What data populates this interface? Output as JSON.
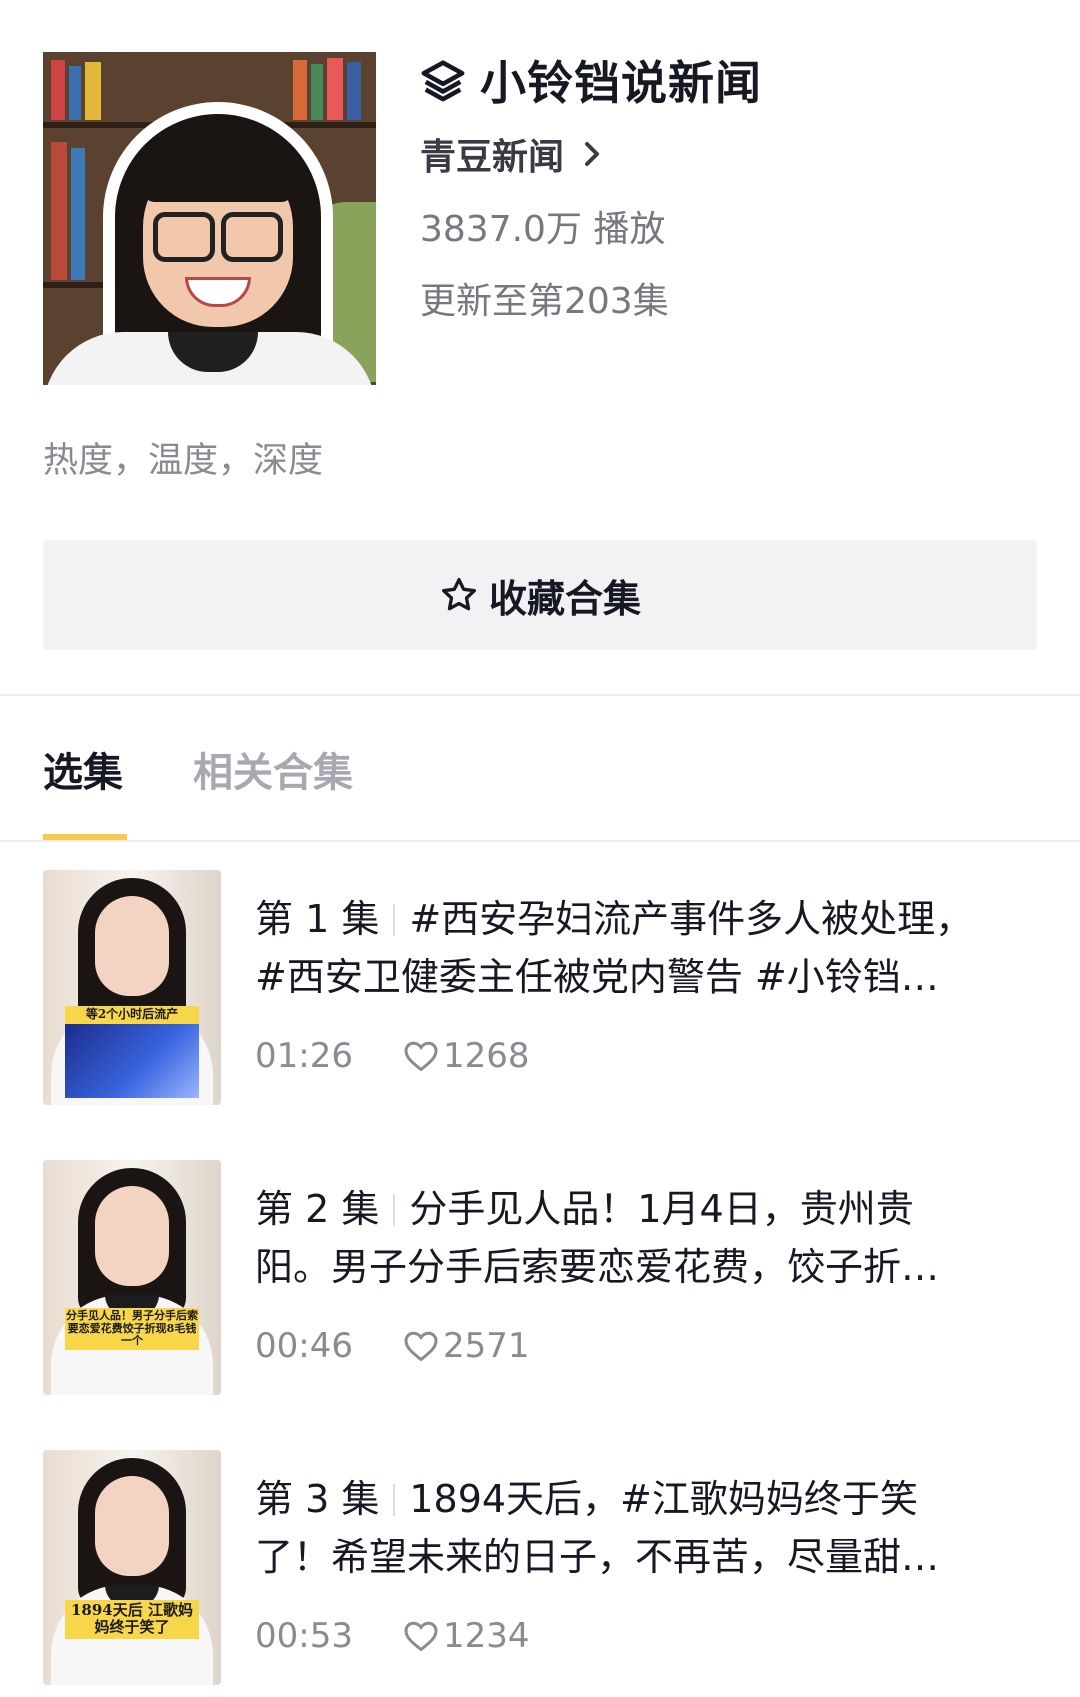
{
  "collection": {
    "title": "小铃铛说新闻",
    "author": "青豆新闻",
    "plays": "3837.0万 播放",
    "updated": "更新至第203集",
    "description": "热度，温度，深度",
    "favorite_label": "收藏合集"
  },
  "tabs": [
    {
      "label": "选集",
      "active": true
    },
    {
      "label": "相关合集",
      "active": false
    }
  ],
  "episodes": [
    {
      "number": "第 1 集",
      "title_line1": "#西安孕妇流产事件多人被处理，",
      "title_line2": "#西安卫健委主任被党内警告 #小铃铛…",
      "duration": "01:26",
      "likes": "1268",
      "thumb_caption": "等2个小时后流产"
    },
    {
      "number": "第 2 集",
      "title_line1": "分手见人品！1月4日，贵州贵",
      "title_line2": "阳。男子分手后索要恋爱花费，饺子折…",
      "duration": "00:46",
      "likes": "2571",
      "thumb_caption": "分手见人品！男子分手后索要恋爱花费饺子折现8毛钱一个"
    },
    {
      "number": "第 3 集",
      "title_line1": "1894天后，#江歌妈妈终于笑",
      "title_line2": "了！希望未来的日子，不再苦，尽量甜…",
      "duration": "00:53",
      "likes": "1234",
      "thumb_caption": "1894天后 江歌妈妈终于笑了"
    }
  ],
  "colors": {
    "tab_indicator": "#f6c94b",
    "button_bg": "#f2f2f4",
    "secondary_text": "#8a8a92"
  }
}
